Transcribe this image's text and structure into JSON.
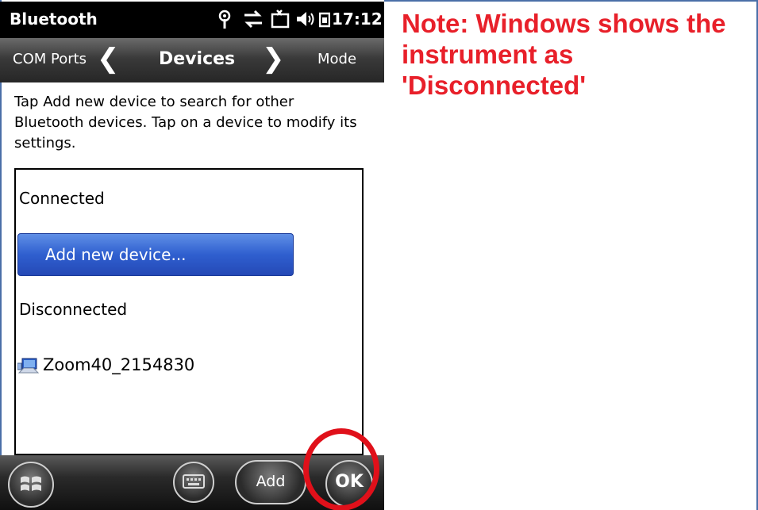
{
  "status_bar": {
    "app_title": "Bluetooth",
    "icons": [
      "antenna-icon",
      "sync-arrows-icon",
      "phone-off-icon",
      "speaker-icon",
      "battery-icon"
    ],
    "clock": "17:12"
  },
  "nav": {
    "left_label": "COM Ports",
    "title": "Devices",
    "right_label": "Mode",
    "prev_glyph": "❮",
    "next_glyph": "❯"
  },
  "instructions": "Tap Add new device to search for other Bluetooth devices. Tap on a device to modify its settings.",
  "devices": {
    "connected_label": "Connected",
    "add_button_label": "Add new device...",
    "disconnected_label": "Disconnected",
    "device_name": "Zoom40_2154830"
  },
  "bottom_bar": {
    "add_label": "Add",
    "ok_label": "OK"
  },
  "note": "Note: Windows shows the instrument as 'Disconnected'",
  "colors": {
    "accent_blue": "#2f5fcf",
    "annotation_red": "#e8202a"
  }
}
